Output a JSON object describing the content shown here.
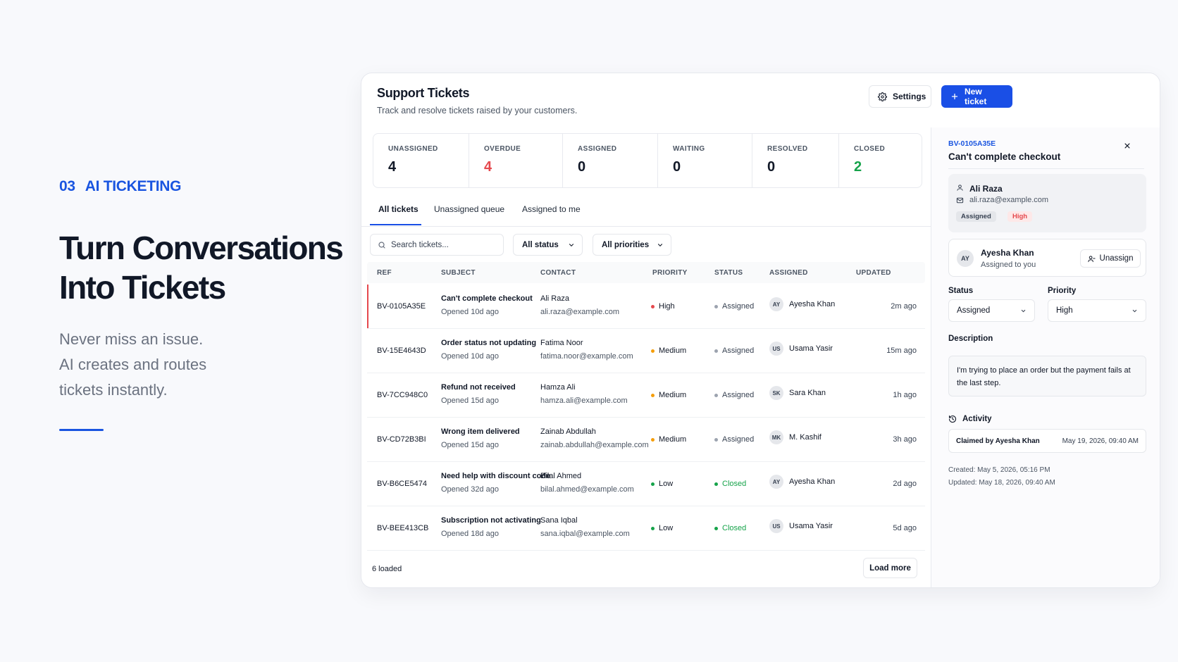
{
  "hero": {
    "section_number": "03",
    "section_title": "AI TICKETING",
    "headline_line1": "Turn Conversations",
    "headline_line2": "Into Tickets",
    "sub_line1": "Never miss an issue.",
    "sub_line2": "AI creates and routes",
    "sub_line3": "tickets instantly.",
    "accent_color": "#1a55e0"
  },
  "app": {
    "title": "Support Tickets",
    "subtitle": "Track and resolve tickets raised by your customers.",
    "settings_label": "Settings",
    "new_ticket_label": "New ticket",
    "primary_color": "#1a4fe6"
  },
  "stats": [
    {
      "label": "UNASSIGNED",
      "value": "4"
    },
    {
      "label": "OVERDUE",
      "value": "4"
    },
    {
      "label": "ASSIGNED",
      "value": "0"
    },
    {
      "label": "WAITING",
      "value": "0"
    },
    {
      "label": "RESOLVED",
      "value": "0"
    },
    {
      "label": "CLOSED",
      "value": "2"
    }
  ],
  "tabs": [
    "All tickets",
    "Unassigned queue",
    "Assigned to me"
  ],
  "filters": {
    "search_placeholder": "Search tickets...",
    "status": "All status",
    "priority": "All priorities"
  },
  "table": {
    "columns": [
      "REF",
      "SUBJECT",
      "CONTACT",
      "PRIORITY",
      "STATUS",
      "ASSIGNED",
      "UPDATED"
    ],
    "rows": [
      {
        "ref": "BV-0105A35E",
        "subject": "Can't complete checkout",
        "opened": "Opened 10d ago",
        "contact": "Ali Raza",
        "email": "ali.raza@example.com",
        "priority": "High",
        "status": "Assigned",
        "initials": "AY",
        "assignee": "Ayesha Khan",
        "updated": "2m ago"
      },
      {
        "ref": "BV-15E4643D",
        "subject": "Order status not updating",
        "opened": "Opened 10d ago",
        "contact": "Fatima Noor",
        "email": "fatima.noor@example.com",
        "priority": "Medium",
        "status": "Assigned",
        "initials": "US",
        "assignee": "Usama Yasir",
        "updated": "15m ago"
      },
      {
        "ref": "BV-7CC948C0",
        "subject": "Refund not received",
        "opened": "Opened 15d ago",
        "contact": "Hamza Ali",
        "email": "hamza.ali@example.com",
        "priority": "Medium",
        "status": "Assigned",
        "initials": "SK",
        "assignee": "Sara Khan",
        "updated": "1h ago"
      },
      {
        "ref": "BV-CD72B3BI",
        "subject": "Wrong item delivered",
        "opened": "Opened 15d ago",
        "contact": "Zainab Abdullah",
        "email": "zainab.abdullah@example.com",
        "priority": "Medium",
        "status": "Assigned",
        "initials": "MK",
        "assignee": "M. Kashif",
        "updated": "3h ago"
      },
      {
        "ref": "BV-B6CE5474",
        "subject": "Need help with discount code",
        "opened": "Opened 32d ago",
        "contact": "Bilal Ahmed",
        "email": "bilal.ahmed@example.com",
        "priority": "Low",
        "status": "Closed",
        "initials": "AY",
        "assignee": "Ayesha Khan",
        "updated": "2d ago"
      },
      {
        "ref": "BV-BEE413CB",
        "subject": "Subscription not activating",
        "opened": "Opened 18d ago",
        "contact": "Sana Iqbal",
        "email": "sana.iqbal@example.com",
        "priority": "Low",
        "status": "Closed",
        "initials": "US",
        "assignee": "Usama Yasir",
        "updated": "5d ago"
      }
    ],
    "loaded_text": "6 loaded",
    "load_more_label": "Load more"
  },
  "detail": {
    "ref": "BV-0105A35E",
    "title": "Can't complete checkout",
    "contact_name": "Ali Raza",
    "contact_email": "ali.raza@example.com",
    "badge_status": "Assigned",
    "badge_priority": "High",
    "assignee_initials": "AY",
    "assignee_name": "Ayesha Khan",
    "assignee_sub": "Assigned to you",
    "unassign_label": "Unassign",
    "status_label": "Status",
    "status_value": "Assigned",
    "priority_label": "Priority",
    "priority_value": "High",
    "description_label": "Description",
    "description_text": "I'm trying to place an order but the payment fails at the last step.",
    "activity_label": "Activity",
    "activity_who": "Claimed by Ayesha Khan",
    "activity_when": "May 19, 2026, 09:40 AM",
    "created": "Created: May 5, 2026, 05:16 PM",
    "updated": "Updated: May 18, 2026, 09:40 AM"
  }
}
